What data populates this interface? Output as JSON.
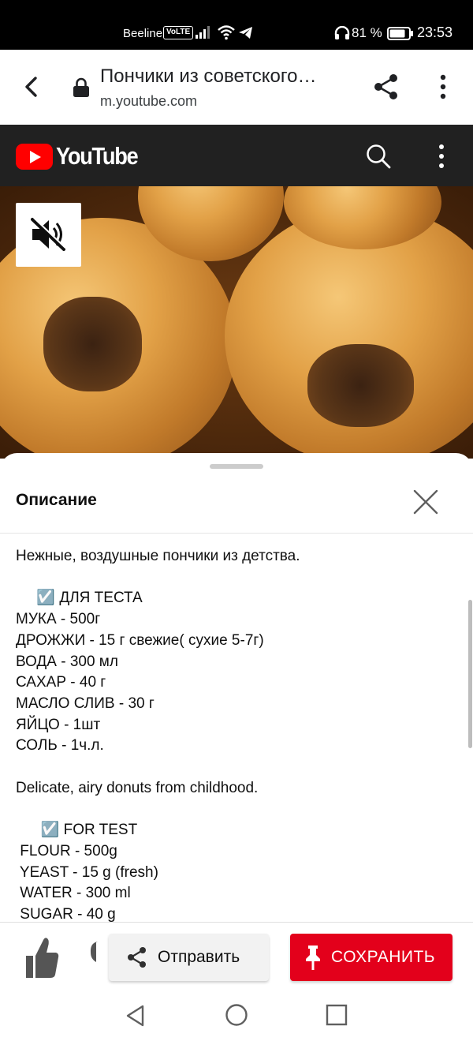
{
  "status_bar": {
    "carrier": "Beeline",
    "volte": "VoLTE",
    "battery_percent": "81 %",
    "time": "23:53",
    "battery_level": 0.81
  },
  "browser": {
    "page_title": "Пончики из советского…",
    "url": "m.youtube.com"
  },
  "youtube": {
    "logo_text": "YouTube"
  },
  "description_panel": {
    "title": "Описание",
    "text": "Нежные, воздушные пончики из детства.\n\n     ☑️ ДЛЯ ТЕСТА\nМУКА - 500г\nДРОЖЖИ - 15 г свежие( сухие 5-7г)\nВОДА - 300 мл\nСАХАР - 40 г\nМАСЛО СЛИВ - 30 г\nЯЙЦО - 1шт\nСОЛЬ - 1ч.л.\n\nDelicate, airy donuts from childhood.\n\n      ☑️ FOR TEST\n FLOUR - 500g\n YEAST - 15 g (fresh)\n WATER - 300 ml\n SUGAR - 40 g"
  },
  "actions": {
    "share_label": "Отправить",
    "save_label": "СОХРАНИТЬ"
  },
  "colors": {
    "youtube_red": "#ff0000",
    "save_button": "#e3001b",
    "header_bg": "#212121"
  }
}
